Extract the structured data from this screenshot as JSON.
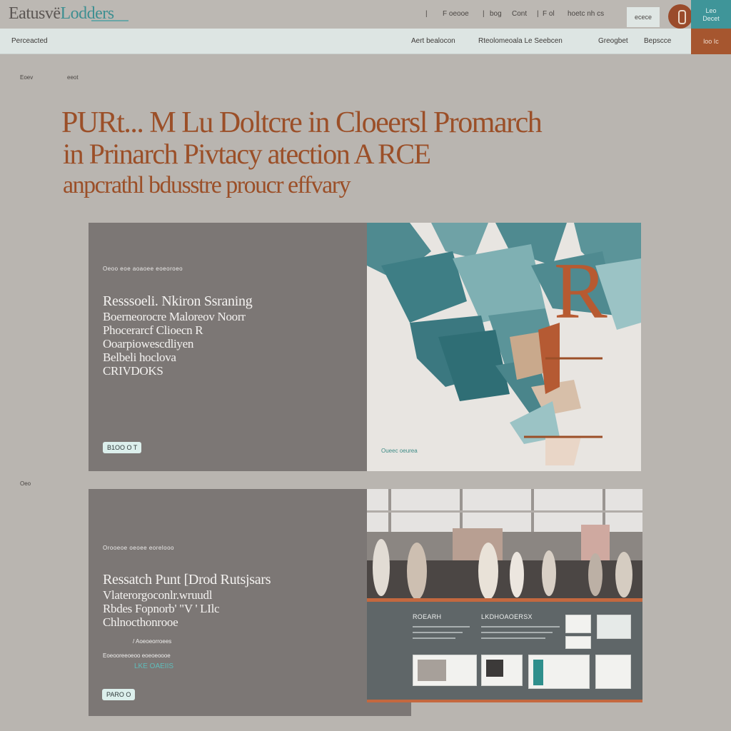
{
  "header": {
    "logo_part1": "Eatusvë",
    "logo_part2": "Lodders",
    "nav": [
      "F oeooe",
      "bog",
      "Cont",
      "F ol",
      "hoetc nh cs"
    ],
    "box_label": "ecece",
    "teal_button": [
      "Leo",
      "Decet"
    ]
  },
  "subheader": {
    "brand": "Perceacted",
    "nav": [
      "Aert bealocon",
      "Rteolomeoala Le Seebcen",
      "Greogbet",
      "Bepscce"
    ],
    "rust_button": "loo Ic"
  },
  "breadcrumbs": [
    "Eoev",
    "eeot"
  ],
  "hero": {
    "line1": "PURt... M Lu Doltcre in Cloeersl Promarch",
    "line2": "in Prinarch Pivtacy  atection A  RCE",
    "line3": "anpcrathl bdusstre proucr  effvary"
  },
  "card1": {
    "kicker": "Oeoo eoe aoaoee eoeoroeo",
    "lines": [
      "Resssoeli. Nkiron Ssraning",
      "Boerneorocre Maloreov Noorr",
      "Phocerarcf Clioecn R",
      "Ooarpiowescdliyen",
      "Belbeli hoclova",
      "CRIVDOKS"
    ],
    "button": "B1OO O T",
    "art_caption": "Oueec oeurea",
    "art_letter": "R"
  },
  "side_label": "Oeo",
  "card2": {
    "kicker": "Orooeoe oeoee eorelooo",
    "lines": [
      "Ressatch Punt [Drod Rutsjsars",
      "Vlaterorgoconlr.wruudl",
      "Rbdes Fopnorb'  \"V ' LIlc",
      "Chlnocthonrooe"
    ],
    "small_text": "/ Aoeoeorroees",
    "small_text2": "Eoeooreeoeoo eoeoeoooe",
    "link_text": "LKE  OAEIIS",
    "button": "PARO O",
    "panel_title1": "ROEARH",
    "panel_title2": "LKDHOAOERSX"
  },
  "colors": {
    "accent_rust": "#9b4f28",
    "accent_teal": "#3f9599",
    "card_bg": "#7c7775",
    "page_bg": "#b9b5b0"
  }
}
